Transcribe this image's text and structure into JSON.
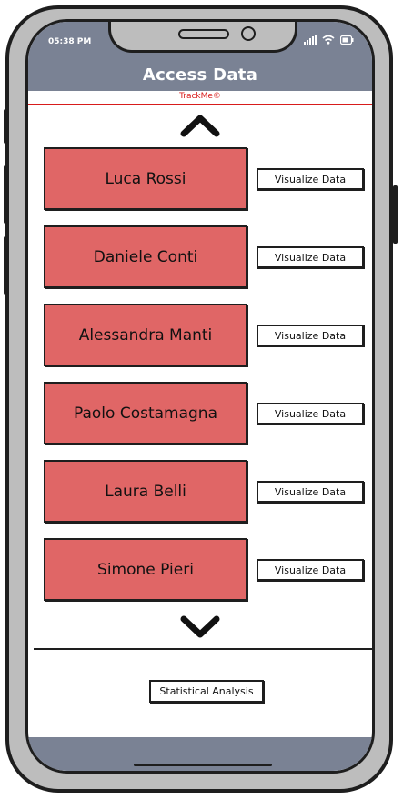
{
  "status_bar": {
    "time": "05:38 PM",
    "icons": [
      "signal-icon",
      "wifi-icon",
      "battery-icon"
    ]
  },
  "app_bar": {
    "title": "Access Data",
    "brand": "TrackMe©"
  },
  "nav": {
    "up_icon": "chevron-up-icon",
    "down_icon": "chevron-down-icon"
  },
  "people": [
    {
      "name": "Luca Rossi",
      "action": "Visualize Data"
    },
    {
      "name": "Daniele Conti",
      "action": "Visualize Data"
    },
    {
      "name": "Alessandra Manti",
      "action": "Visualize Data"
    },
    {
      "name": "Paolo Costamagna",
      "action": "Visualize Data"
    },
    {
      "name": "Laura Belli",
      "action": "Visualize Data"
    },
    {
      "name": "Simone Pieri",
      "action": "Visualize Data"
    }
  ],
  "footer": {
    "stats_label": "Statistical Analysis"
  },
  "colors": {
    "bar": "#7a8294",
    "card": "#e06666",
    "brand": "#d81b1b",
    "frame": "#bdbdbd"
  }
}
